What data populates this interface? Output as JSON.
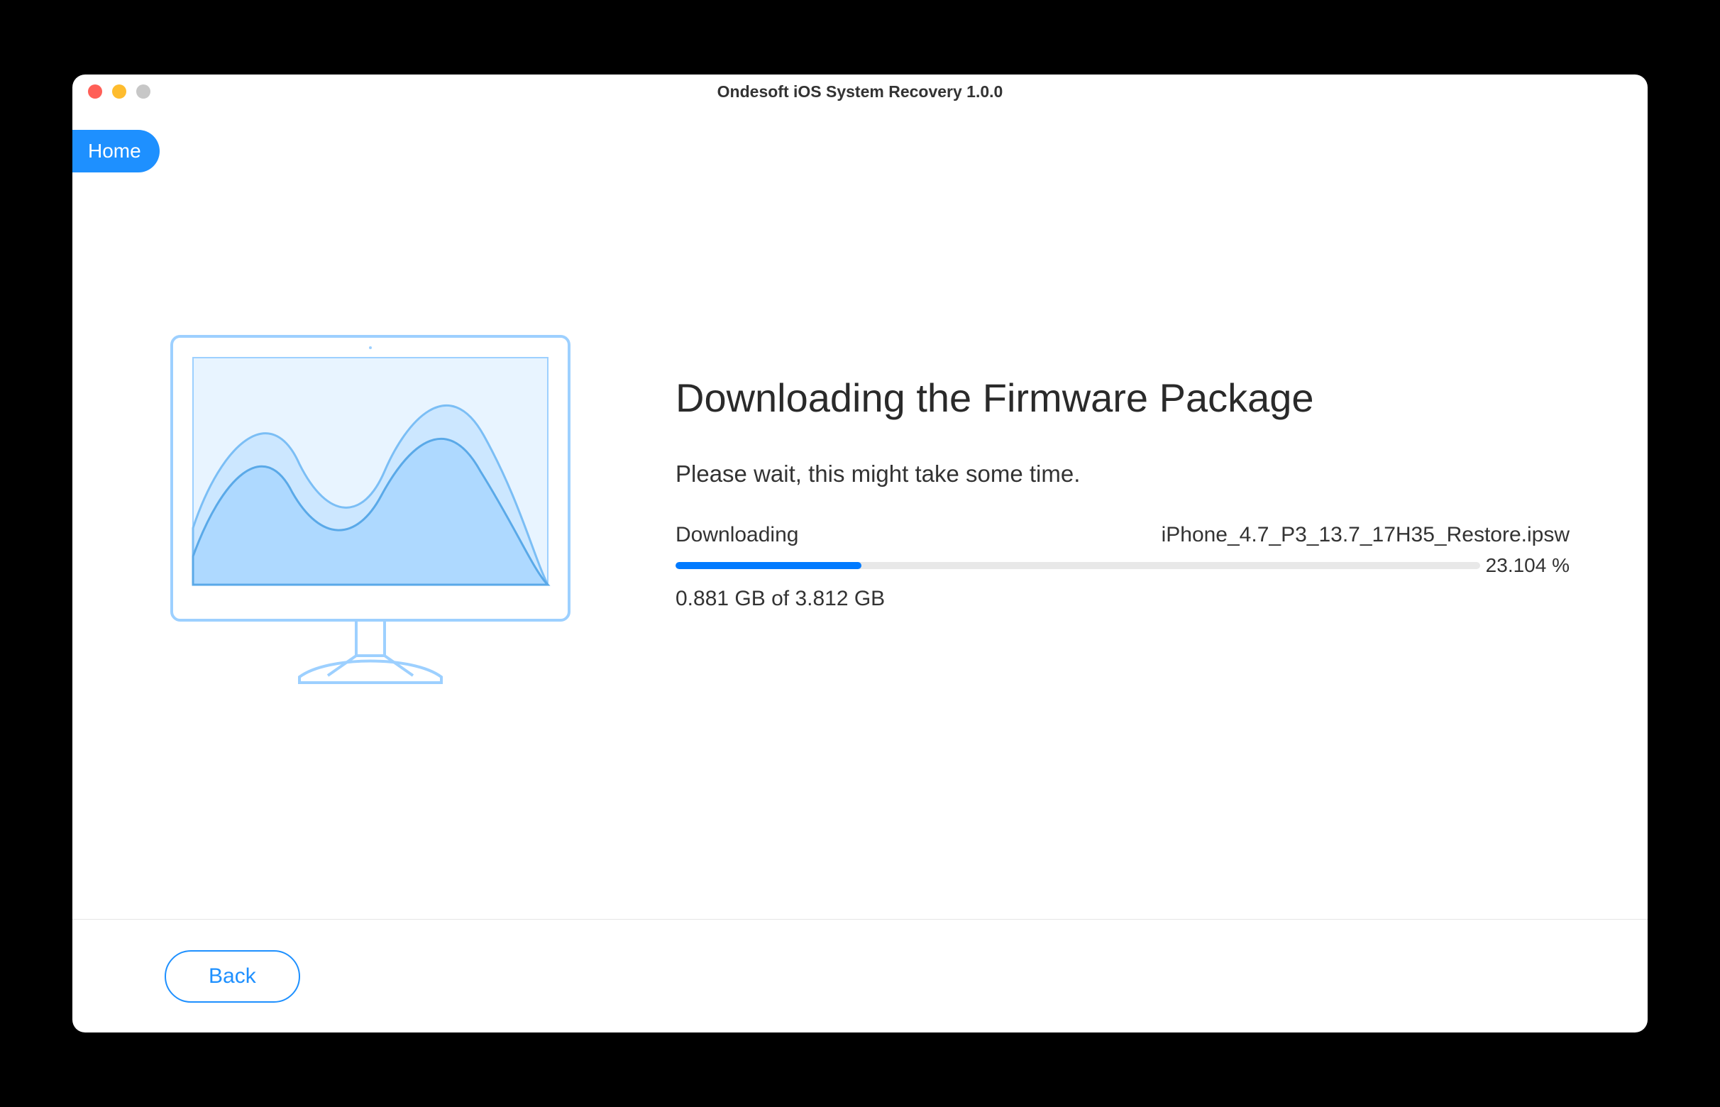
{
  "window": {
    "title": "Ondesoft iOS System Recovery 1.0.0"
  },
  "nav": {
    "home_label": "Home"
  },
  "main": {
    "heading": "Downloading the Firmware Package",
    "subheading": "Please wait, this might take some time.",
    "status_label": "Downloading",
    "filename": "iPhone_4.7_P3_13.7_17H35_Restore.ipsw",
    "progress_percent": 23.104,
    "progress_percent_text": "23.104 %",
    "size_text": "0.881 GB of 3.812 GB"
  },
  "footer": {
    "back_label": "Back"
  },
  "colors": {
    "accent": "#1e90ff",
    "progress": "#007aff"
  }
}
